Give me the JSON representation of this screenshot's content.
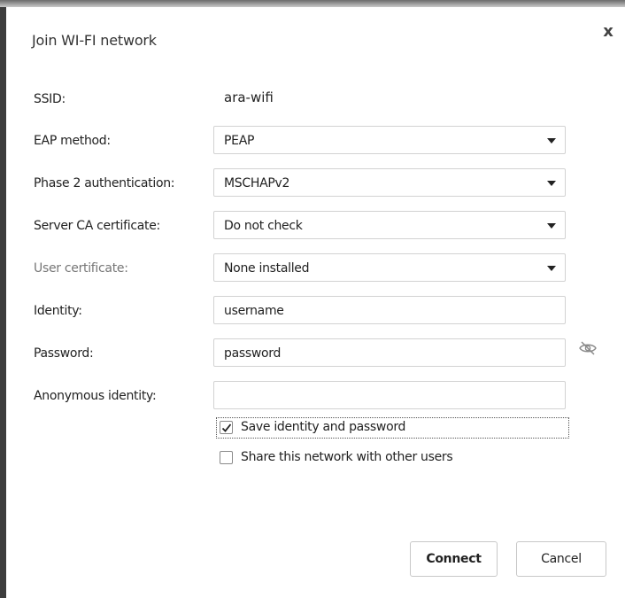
{
  "dialog": {
    "title": "Join WI-FI network",
    "close_icon": "close-icon",
    "close_glyph": "x"
  },
  "fields": {
    "ssid": {
      "label": "SSID:",
      "value": "ara-wifi"
    },
    "eap_method": {
      "label": "EAP method:",
      "value": "PEAP"
    },
    "phase2": {
      "label": "Phase 2 authentication:",
      "value": "MSCHAPv2"
    },
    "server_ca": {
      "label": "Server CA certificate:",
      "value": "Do not check"
    },
    "user_cert": {
      "label": "User certificate:",
      "value": "None installed"
    },
    "identity": {
      "label": "Identity:",
      "value": "username"
    },
    "password": {
      "label": "Password:",
      "value": "password",
      "toggle_icon": "eye-off-icon"
    },
    "anonymous_identity": {
      "label": "Anonymous identity:",
      "value": ""
    }
  },
  "options": {
    "save_identity": {
      "label": "Save identity and password",
      "checked": true
    },
    "share_network": {
      "label": "Share this network with other users",
      "checked": false
    }
  },
  "buttons": {
    "connect": "Connect",
    "cancel": "Cancel"
  },
  "colors": {
    "dialog_bg": "#ffffff",
    "border": "#d2d2d2",
    "text": "#222222",
    "disabled_text": "#777777"
  }
}
